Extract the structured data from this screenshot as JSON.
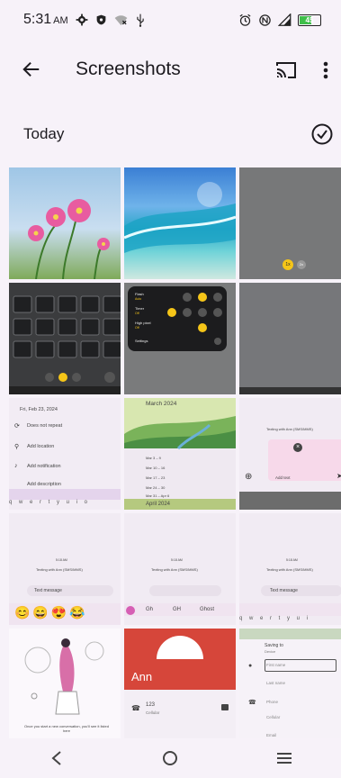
{
  "status_bar": {
    "time": "5:31",
    "ampm": "AM",
    "battery": "45"
  },
  "app_bar": {
    "title": "Screenshots"
  },
  "section": {
    "label": "Today"
  },
  "thumbnails": {
    "cell_4_date": "Fri, Feb 23, 2024",
    "cell_4_repeat": "Does not repeat",
    "cell_4_location": "Add location",
    "cell_4_notification": "Add notification",
    "cell_4_description": "Add description",
    "cell_5_month": "March 2024",
    "cell_5_weeks": [
      "Mar 3 – 9",
      "Mar 10 – 16",
      "Mar 17 – 23",
      "Mar 24 – 30",
      "Mar 31 – Apr 6"
    ],
    "cell_5_next": "April 2024",
    "texting_label": "Texting with Ann (SMS/MMS)",
    "text_message": "Text message",
    "add_text": "Add text",
    "time_stamp": "5:18 AM",
    "kbd_words": [
      "Gh",
      "GH",
      "Ghost"
    ],
    "empty_chat": "Once you start a new conversation, you'll see it listed here",
    "contact_name": "Ann",
    "contact_number": "123",
    "contact_type": "Cellular",
    "saving_to": "Saving to",
    "saving_device": "Device",
    "first_name": "First name",
    "last_name": "Last name",
    "phone": "Phone",
    "cellular": "Cellular",
    "email": "Email",
    "camera_settings": [
      "Flash",
      "Timer",
      "High pixel",
      "Settings"
    ],
    "camera_values": [
      "Auto",
      "Off",
      "Off"
    ],
    "zoom_1x": "1x",
    "zoom_2x": "2x",
    "zoom_05": "0.5x"
  }
}
